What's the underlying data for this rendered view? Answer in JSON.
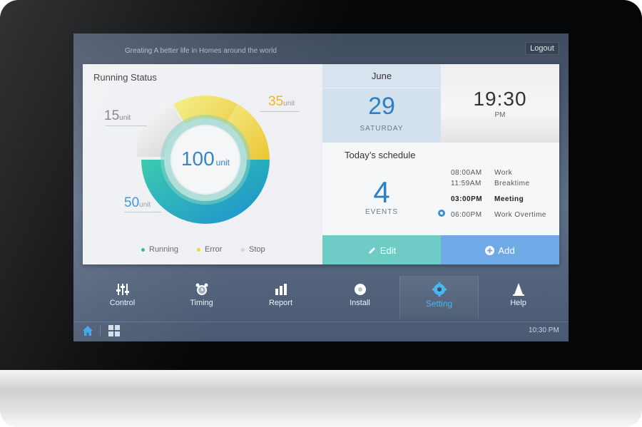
{
  "header": {
    "tagline": "Greating A better life in Homes around the world",
    "logout_label": "Logout"
  },
  "running_status": {
    "title": "Running Status",
    "total_value": "100",
    "total_unit": "unit",
    "labels": [
      {
        "value": "15",
        "unit": "unit",
        "color": "#7d7d7d"
      },
      {
        "value": "35",
        "unit": "unit",
        "color": "#f2b31c"
      },
      {
        "value": "50",
        "unit": "unit",
        "color": "#3b8fd6"
      }
    ],
    "legend": [
      {
        "label": "Running",
        "color": "#2bb5a6"
      },
      {
        "label": "Error",
        "color": "#f2d23a"
      },
      {
        "label": "Stop",
        "color": "#d6d6d6"
      }
    ]
  },
  "date": {
    "month": "June",
    "day": "29",
    "weekday": "SATURDAY"
  },
  "clock": {
    "time": "19:30",
    "ampm": "PM"
  },
  "schedule": {
    "title": "Today’s schedule",
    "count": "4",
    "count_label": "EVENTS",
    "items": [
      {
        "time": "08:00AM",
        "label": "Work"
      },
      {
        "time": "11:59AM",
        "label": "Breaktime"
      },
      {
        "time": "03:00PM",
        "label": "Meeting"
      },
      {
        "time": "06:00PM",
        "label": "Work Overtime"
      }
    ]
  },
  "actions": {
    "edit_label": "Edit",
    "add_label": "Add"
  },
  "nav": [
    {
      "label": "Control",
      "icon": "sliders-icon"
    },
    {
      "label": "Timing",
      "icon": "alarm-clock-icon"
    },
    {
      "label": "Report",
      "icon": "bar-chart-icon"
    },
    {
      "label": "Install",
      "icon": "disc-icon"
    },
    {
      "label": "Setting",
      "icon": "gear-icon"
    },
    {
      "label": "Help",
      "icon": "cone-icon"
    }
  ],
  "footer": {
    "time": "10:30 PM"
  }
}
